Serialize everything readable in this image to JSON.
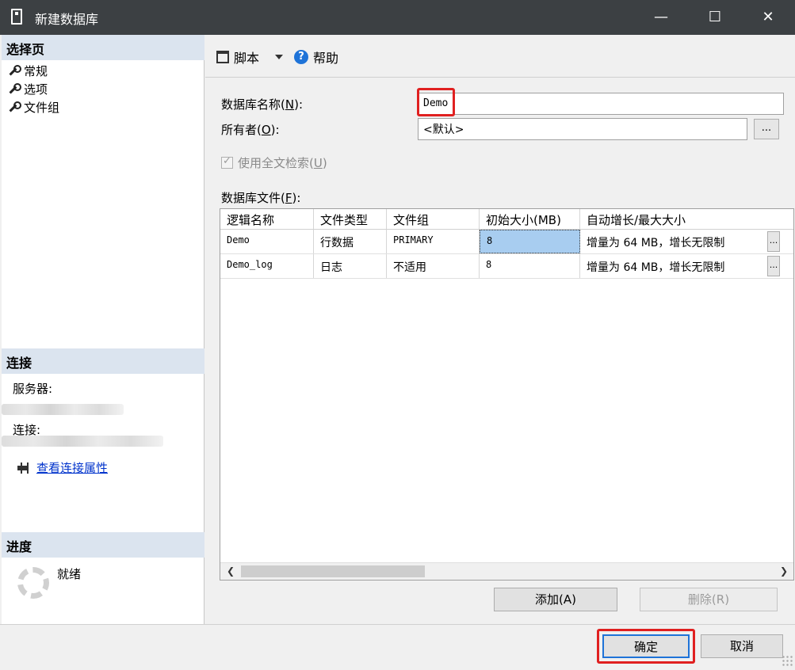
{
  "window": {
    "title": "新建数据库",
    "controls": {
      "minimize": "—",
      "maximize": "☐",
      "close": "✕"
    }
  },
  "left": {
    "select_page_header": "选择页",
    "pages": [
      "常规",
      "选项",
      "文件组"
    ],
    "connection_header": "连接",
    "server_label": "服务器:",
    "connection_label": "连接:",
    "view_connection_properties": "查看连接属性",
    "progress_header": "进度",
    "progress_status": "就绪"
  },
  "toolbar": {
    "script_label": "脚本",
    "help_label": "帮助"
  },
  "form": {
    "db_name_label": "数据库名称(",
    "db_name_key": "N",
    "db_name_suffix": "):",
    "db_name_value": "Demo",
    "owner_label": "所有者(",
    "owner_key": "O",
    "owner_suffix": "):",
    "owner_value": "<默认>",
    "browse_button": "...",
    "fulltext_label": "使用全文检索(",
    "fulltext_key": "U",
    "fulltext_suffix": ")",
    "files_label": "数据库文件(",
    "files_key": "F",
    "files_suffix": "):"
  },
  "grid": {
    "columns": [
      "逻辑名称",
      "文件类型",
      "文件组",
      "初始大小(MB)",
      "自动增长/最大大小"
    ],
    "rows": [
      [
        "Demo",
        "行数据",
        "PRIMARY",
        "8",
        "增量为 64 MB，增长无限制"
      ],
      [
        "Demo_log",
        "日志",
        "不适用",
        "8",
        "增量为 64 MB，增长无限制"
      ]
    ],
    "row_button": "..."
  },
  "buttons": {
    "add": "添加(A)",
    "remove": "删除(R)",
    "ok": "确定",
    "cancel": "取消"
  },
  "colors": {
    "titlebar": "#3c4043",
    "section_header": "#dbe4ef",
    "highlight": "#e02020",
    "selection": "#a8cdf0",
    "link": "#0033cc"
  }
}
